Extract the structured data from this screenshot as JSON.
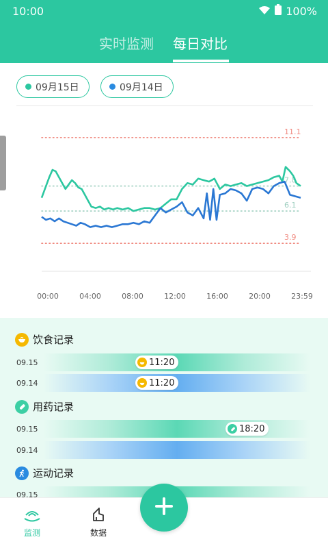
{
  "status_bar": {
    "time": "10:00",
    "battery": "100%",
    "wifi_icon": "wifi-icon",
    "battery_icon": "battery-icon"
  },
  "tabs": [
    {
      "label": "实时监测",
      "active": false
    },
    {
      "label": "每日对比",
      "active": true
    }
  ],
  "date_chips": [
    {
      "label": "09月15日",
      "color": "#2cc7a0"
    },
    {
      "label": "09月14日",
      "color": "#2a8be0"
    }
  ],
  "colors": {
    "primary": "#2cc7a0",
    "series_1": "#2cc7a0",
    "series_2": "#2a77d3",
    "limit_line": "#f08a80"
  },
  "chart_data": {
    "type": "line",
    "xlabel": "",
    "ylabel": "",
    "x_ticks": [
      "00:00",
      "04:00",
      "08:00",
      "12:00",
      "16:00",
      "20:00",
      "23:59"
    ],
    "ylim": [
      2,
      13
    ],
    "reference_lines": [
      {
        "value": 11.1,
        "label": "11.1",
        "color": "#f08a80"
      },
      {
        "value": 7.8,
        "label": "7.8",
        "color": "#9fcfc0"
      },
      {
        "value": 6.1,
        "label": "6.1",
        "color": "#9fcfc0"
      },
      {
        "value": 3.9,
        "label": "3.9",
        "color": "#f08a80"
      }
    ],
    "series": [
      {
        "name": "09月15日",
        "color": "#2cc7a0",
        "x_hours": [
          0,
          0.3,
          0.7,
          1.0,
          1.3,
          1.6,
          1.9,
          2.2,
          2.5,
          2.8,
          3.1,
          3.4,
          3.7,
          4.0,
          4.3,
          4.6,
          5.0,
          5.4,
          5.8,
          6.2,
          6.6,
          7.0,
          7.5,
          8.0,
          8.5,
          9.0,
          9.5,
          10.0,
          10.5,
          11.0,
          11.5,
          12.0,
          12.5,
          13.0,
          13.5,
          14.0,
          14.5,
          15.0,
          15.5,
          16.0,
          16.5,
          17.0,
          17.5,
          18.0,
          18.5,
          19.0,
          19.5,
          20.0,
          20.5,
          21.0,
          21.5,
          22.0,
          22.3,
          22.6,
          23.0,
          23.3,
          23.6,
          23.99
        ],
        "values": [
          7.0,
          7.6,
          8.4,
          8.9,
          8.8,
          8.4,
          8.0,
          7.6,
          7.9,
          8.2,
          8.0,
          7.7,
          7.6,
          7.2,
          6.8,
          6.4,
          6.3,
          6.4,
          6.2,
          6.3,
          6.2,
          6.3,
          6.2,
          6.3,
          6.1,
          6.2,
          6.3,
          6.3,
          6.2,
          6.3,
          6.6,
          6.9,
          6.9,
          7.6,
          8.0,
          7.9,
          8.3,
          8.2,
          8.1,
          8.3,
          7.6,
          7.9,
          7.8,
          7.9,
          8.0,
          7.8,
          7.9,
          8.0,
          8.1,
          8.2,
          8.4,
          8.5,
          8.1,
          9.1,
          8.8,
          8.5,
          8.0,
          7.8
        ]
      },
      {
        "name": "09月14日",
        "color": "#2a77d3",
        "x_hours": [
          0,
          0.4,
          0.8,
          1.2,
          1.6,
          2.0,
          2.4,
          2.8,
          3.2,
          3.6,
          4.0,
          4.5,
          5.0,
          5.5,
          6.0,
          6.5,
          7.0,
          7.5,
          8.0,
          8.5,
          9.0,
          9.5,
          10.0,
          10.5,
          11.0,
          11.5,
          12.0,
          12.5,
          13.0,
          13.5,
          14.0,
          14.5,
          15.0,
          15.3,
          15.6,
          15.9,
          16.2,
          16.5,
          17.0,
          17.5,
          18.0,
          18.5,
          19.0,
          19.5,
          20.0,
          20.5,
          21.0,
          21.5,
          22.0,
          22.5,
          23.0,
          23.5,
          23.99
        ],
        "values": [
          5.7,
          5.5,
          5.6,
          5.4,
          5.6,
          5.4,
          5.3,
          5.2,
          5.1,
          5.3,
          5.2,
          5.0,
          5.1,
          5.0,
          5.1,
          5.0,
          5.1,
          5.2,
          5.2,
          5.3,
          5.2,
          5.4,
          5.3,
          5.8,
          6.3,
          6.0,
          6.2,
          6.4,
          6.7,
          6.0,
          5.8,
          6.3,
          5.6,
          7.3,
          5.5,
          7.6,
          5.5,
          7.2,
          7.3,
          7.6,
          7.5,
          7.3,
          6.8,
          7.6,
          7.7,
          7.6,
          7.3,
          7.8,
          8.0,
          8.1,
          7.2,
          7.1,
          7.0
        ]
      }
    ]
  },
  "records": {
    "diet": {
      "title": "饮食记录",
      "icon": "bowl-icon",
      "rows": [
        {
          "date": "09.15",
          "marker": "11:20"
        },
        {
          "date": "09.14",
          "marker": "11:20"
        }
      ]
    },
    "medication": {
      "title": "用药记录",
      "icon": "pill-icon",
      "rows": [
        {
          "date": "09.15",
          "marker": "18:20"
        },
        {
          "date": "09.14",
          "marker": ""
        }
      ]
    },
    "exercise": {
      "title": "运动记录",
      "icon": "running-icon",
      "rows": [
        {
          "date": "09.15",
          "marker": ""
        }
      ]
    }
  },
  "bottom_nav": [
    {
      "label": "监测",
      "icon": "monitor-icon",
      "active": true
    },
    {
      "label": "数据",
      "icon": "data-icon",
      "active": false
    }
  ],
  "fab": {
    "icon": "plus-icon"
  }
}
